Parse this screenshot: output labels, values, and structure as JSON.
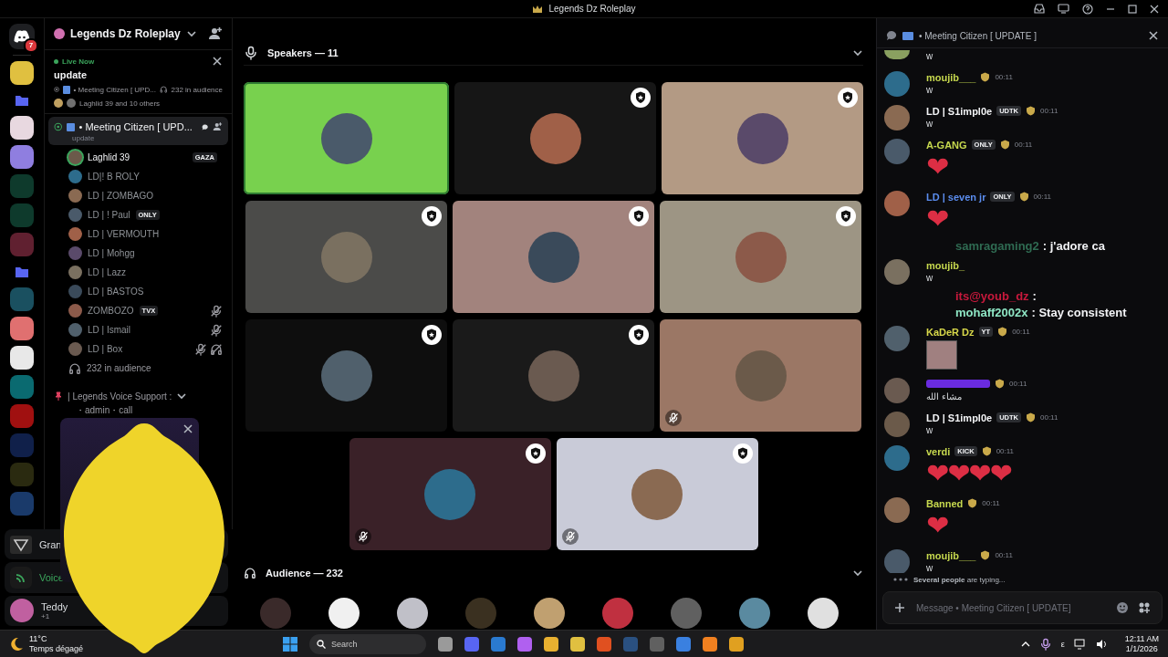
{
  "window": {
    "title": "Legends Dz Roleplay"
  },
  "rail": {
    "badge": "7"
  },
  "sidebar": {
    "server": "Legends Dz Roleplay",
    "live": {
      "label": "Live Now",
      "topic": "update",
      "channel": "• Meeting Citizen [ UPD...",
      "audience": "232 in audience",
      "speakers": "Laghlid 39 and 10 others"
    },
    "channel": {
      "name": "• Meeting Citizen [ UPD...",
      "topic": "update",
      "selected": true
    },
    "members": [
      {
        "name": "Laghlid 39",
        "tag": "GAZA",
        "speaking": true,
        "muted": false,
        "deafened": false
      },
      {
        "name": "LD|! B ROLY",
        "speaking": false,
        "muted": false,
        "deafened": false
      },
      {
        "name": "LD | ZOMBAGO",
        "speaking": false,
        "muted": false,
        "deafened": false
      },
      {
        "name": "LD | ! Paul",
        "tag": "ONLY",
        "speaking": false,
        "muted": false,
        "deafened": false
      },
      {
        "name": "LD | VERMOUTH",
        "speaking": false,
        "muted": false,
        "deafened": false
      },
      {
        "name": "LD | Mohgg",
        "speaking": false,
        "muted": false,
        "deafened": false
      },
      {
        "name": "LD | Lazz",
        "speaking": false,
        "muted": false,
        "deafened": false
      },
      {
        "name": "LD | BASTOS",
        "speaking": false,
        "muted": false,
        "deafened": false
      },
      {
        "name": "ZOMBOZO",
        "tag": "TVX",
        "speaking": false,
        "muted": true,
        "deafened": false
      },
      {
        "name": "LD | Ismail",
        "speaking": false,
        "muted": true,
        "deafened": false
      },
      {
        "name": "LD | Box",
        "speaking": false,
        "muted": true,
        "deafened": true
      }
    ],
    "audience": "232 in audience",
    "category": "| Legends Voice Support :",
    "subchannel": "・admin・call",
    "activity": "Gran",
    "voice": "Voice",
    "user": {
      "name": "Teddy",
      "status": "+1"
    }
  },
  "stage": {
    "speakers_label": "Speakers — 11",
    "audience_label": "Audience — 232",
    "tiles": [
      {
        "color": "#78d14e",
        "speaking": true,
        "moderator": false,
        "muted": false
      },
      {
        "color": "#161616",
        "speaking": false,
        "moderator": true,
        "muted": false
      },
      {
        "color": "#b39a84",
        "speaking": false,
        "moderator": true,
        "muted": false
      },
      {
        "color": "#4b4b49",
        "speaking": false,
        "moderator": true,
        "muted": false
      },
      {
        "color": "#a2837d",
        "speaking": false,
        "moderator": true,
        "muted": false
      },
      {
        "color": "#9d9584",
        "speaking": false,
        "moderator": true,
        "muted": false
      },
      {
        "color": "#0e0e0e",
        "speaking": false,
        "moderator": true,
        "muted": false
      },
      {
        "color": "#1a1a1a",
        "speaking": false,
        "moderator": true,
        "muted": false
      },
      {
        "color": "#9b7765",
        "speaking": false,
        "moderator": false,
        "muted": true
      },
      {
        "color": "#3a2128",
        "speaking": false,
        "moderator": true,
        "muted": true
      },
      {
        "color": "#c9cbd8",
        "speaking": false,
        "moderator": true,
        "muted": true
      }
    ]
  },
  "chat": {
    "title": "• Meeting Citizen [ UPDATE ]",
    "messages": [
      {
        "kind": "continuation",
        "text": "w"
      },
      {
        "kind": "message",
        "author": "moujib___",
        "color": "#c6d84e",
        "time": "00:11",
        "text": "w"
      },
      {
        "kind": "message",
        "author": "LD | S1impl0e",
        "color": "#f2f3f5",
        "tag": "UDTK",
        "time": "00:11",
        "text": "w"
      },
      {
        "kind": "message",
        "author": "A-GANG",
        "color": "#c6d84e",
        "tag": "ONLY",
        "time": "00:11",
        "emoji": "❤"
      },
      {
        "kind": "message",
        "author": "LD | seven jr",
        "color": "#5b8def",
        "tag": "ONLY",
        "time": "00:11",
        "emoji": "❤"
      },
      {
        "kind": "overlay",
        "user": "samragaming2",
        "color": "#2f6b52",
        "text": ": j'adore ca"
      },
      {
        "kind": "message",
        "author": "moujib_",
        "color": "#c6d84e",
        "text": "w"
      },
      {
        "kind": "overlay",
        "user": "its@youb_dz",
        "color": "#c8193c",
        "text": ":"
      },
      {
        "kind": "overlay",
        "user": "mohaff2002x",
        "color": "#8ee6c4",
        "text": ": Stay consistent"
      },
      {
        "kind": "image",
        "author": "KaDeR Dz",
        "color": "#d8d84a",
        "tag": "YT",
        "time": "00:11"
      },
      {
        "kind": "message",
        "color": "#6a2be0",
        "time": "00:11",
        "text": "مشاء الله"
      },
      {
        "kind": "message",
        "author": "LD | S1impl0e",
        "color": "#f2f3f5",
        "tag": "UDTK",
        "time": "00:11",
        "text": "w"
      },
      {
        "kind": "message",
        "author": "verdi",
        "color": "#c6d84e",
        "tag": "KICK",
        "time": "00:11",
        "emoji": "❤❤❤❤"
      },
      {
        "kind": "message",
        "author": "Banned",
        "color": "#c6d84e",
        "time": "00:11",
        "emoji": "❤"
      },
      {
        "kind": "message",
        "author": "moujib___",
        "color": "#c6d84e",
        "time": "00:11",
        "text": "w"
      }
    ],
    "typing": "**Several people** are typing...",
    "placeholder": "Message • Meeting Citizen [ UPDATE]"
  },
  "taskbar": {
    "temperature": "11°C",
    "weather": "Temps dégagé",
    "search": "Search",
    "time": "12:11 AM",
    "date": "1/1/2026",
    "tray_letter": "ε"
  }
}
